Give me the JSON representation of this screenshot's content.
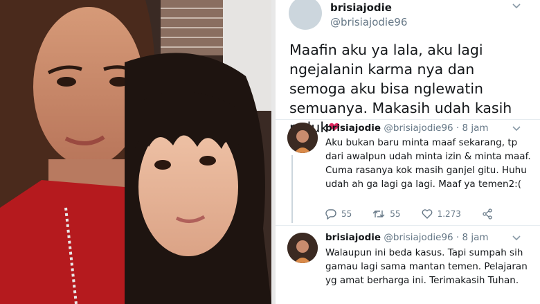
{
  "main_tweet": {
    "name": "brisiajodie",
    "handle": "@brisiajodie96",
    "text": "Maafin aku ya lala, aku lagi ngejalanin karma nya dan semoga aku bisa nglewatin semuanya. Makasih udah kasih peluk",
    "emoji": "❤"
  },
  "replies": [
    {
      "name": "brisiajodie",
      "handle": "@brisiajodie96",
      "time": "· 8 jam",
      "text": "Aku bukan baru minta maaf sekarang, tp dari awalpun udah minta izin & minta maaf. Cuma rasanya kok masih ganjel gitu. Huhu udah ah ga lagi ga lagi. Maaf ya temen2:(",
      "reply_count": "55",
      "retweet_count": "55",
      "like_count": "1.273"
    },
    {
      "name": "brisiajodie",
      "handle": "@brisiajodie96",
      "time": "· 8 jam",
      "text": "Walaupun ini beda kasus. Tapi sumpah sih gamau lagi sama mantan temen. Pelajaran yg amat berharga ini. Terimakasih Tuhan."
    }
  ],
  "colors": {
    "accent_heart": "#e0245e",
    "muted": "#657786",
    "text": "#14171a"
  }
}
